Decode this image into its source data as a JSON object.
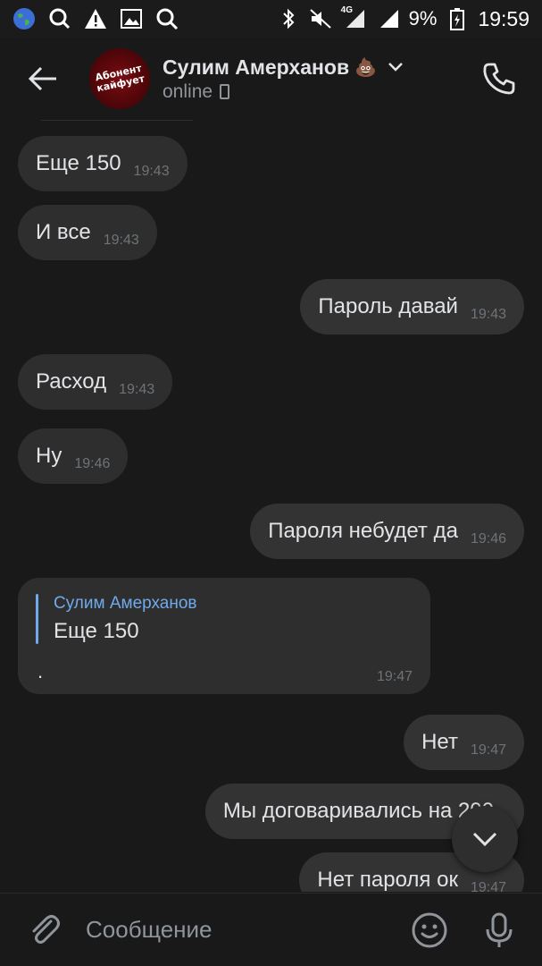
{
  "status_bar": {
    "icons_left": [
      "globe-icon",
      "search-refresh-icon",
      "warning-icon",
      "image-icon",
      "search-icon"
    ],
    "icons_right": [
      "bluetooth-icon",
      "mute-icon",
      "signal-4g-icon",
      "signal-icon"
    ],
    "network_label": "4G",
    "battery_percent": "9%",
    "time": "19:59"
  },
  "header": {
    "contact_name": "Сулим Амерханов",
    "name_emoji": "💩",
    "status": "online",
    "avatar_text": "Абонент кайфует"
  },
  "messages": [
    {
      "direction": "in",
      "text": "Еще 150",
      "time": "19:43"
    },
    {
      "direction": "in",
      "text": "И все",
      "time": "19:43"
    },
    {
      "direction": "out",
      "text": "Пароль давай",
      "time": "19:43"
    },
    {
      "direction": "in",
      "text": "Расход",
      "time": "19:43"
    },
    {
      "direction": "in",
      "text": "Ну",
      "time": "19:46"
    },
    {
      "direction": "out",
      "text": "Пароля небудет да",
      "time": "19:46"
    },
    {
      "direction": "in",
      "reply_to_author": "Сулим Амерханов",
      "reply_to_text": "Еще 150",
      "text": ".",
      "time": "19:47"
    },
    {
      "direction": "out",
      "text": "Нет",
      "time": "19:47"
    },
    {
      "direction": "out",
      "text": "Мы договаривались на 200",
      "time": ""
    },
    {
      "direction": "out",
      "text": "Нет пароля ок",
      "time": "19:47"
    }
  ],
  "composer": {
    "placeholder": "Сообщение"
  },
  "colors": {
    "background": "#191919",
    "bubble": "#2e2e2e",
    "accent_blue": "#71aaeb",
    "text": "#e1e3e6",
    "time_text": "#6e7378"
  }
}
